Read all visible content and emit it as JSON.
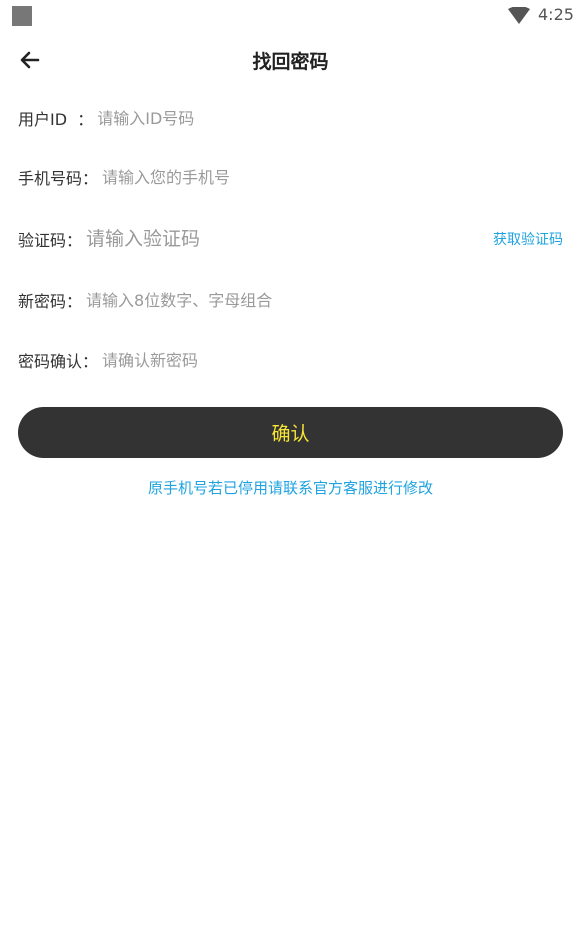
{
  "status_bar": {
    "time": "4:25"
  },
  "header": {
    "title": "找回密码"
  },
  "form": {
    "user_id": {
      "label": "用户ID  ：",
      "placeholder": "请输入ID号码"
    },
    "phone": {
      "label": "手机号码：",
      "placeholder": "请输入您的手机号"
    },
    "code": {
      "label": "验证码：",
      "placeholder": "请输入验证码",
      "action": "获取验证码"
    },
    "new_password": {
      "label": "新密码：",
      "placeholder": "请输入8位数字、字母组合"
    },
    "confirm_password": {
      "label": "密码确认：",
      "placeholder": "请确认新密码"
    }
  },
  "confirm_button": {
    "label": "确认"
  },
  "notice": "原手机号若已停用请联系官方客服进行修改",
  "colors": {
    "button_bg": "#333333",
    "button_text": "#f6e534",
    "link": "#1fa3e0"
  }
}
